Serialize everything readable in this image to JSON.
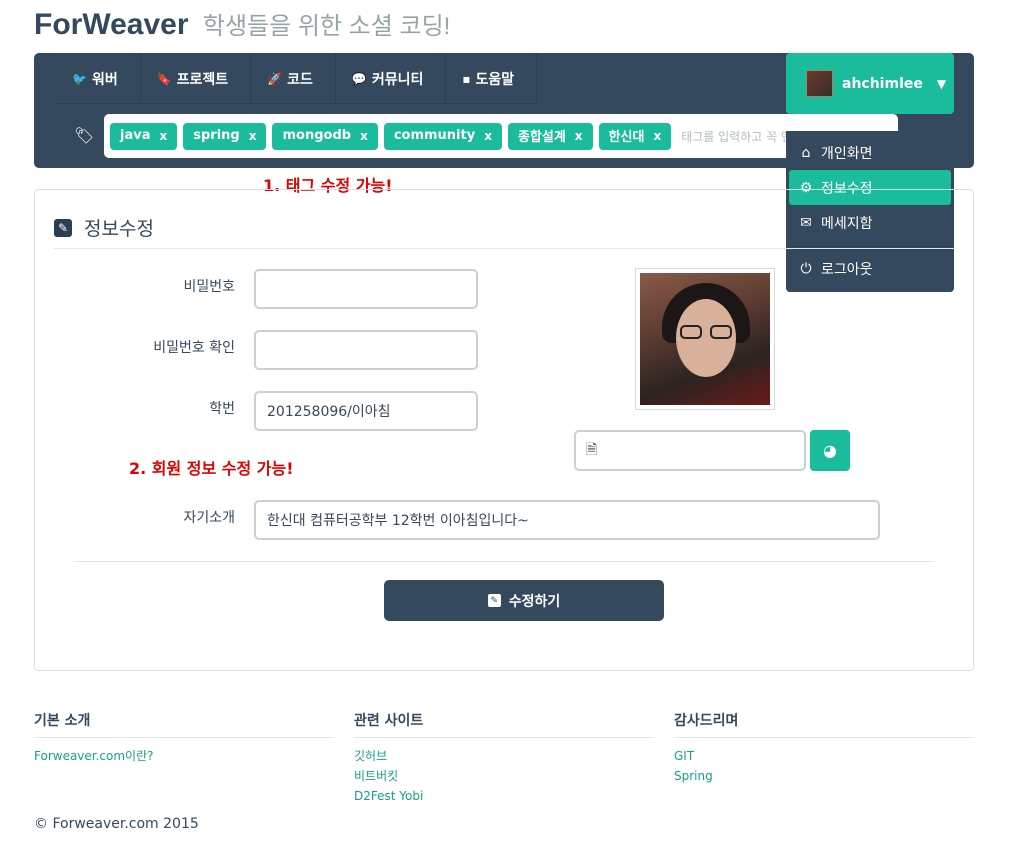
{
  "brand": {
    "name": "ForWeaver",
    "tagline": "학생들을 위한 소셜 코딩!"
  },
  "nav": {
    "items": [
      {
        "icon": "twitter-icon",
        "glyph": "🐦",
        "label": "워버"
      },
      {
        "icon": "bookmark-icon",
        "glyph": "🔖",
        "label": "프로젝트"
      },
      {
        "icon": "rocket-icon",
        "glyph": "🚀",
        "label": "코드"
      },
      {
        "icon": "comments-icon",
        "glyph": "💬",
        "label": "커뮤니티"
      },
      {
        "icon": "help-icon",
        "glyph": "▪",
        "label": "도움말"
      }
    ],
    "tags": [
      "java",
      "spring",
      "mongodb",
      "community",
      "종합설계",
      "한신대"
    ],
    "tag_remove": "x",
    "tag_placeholder": "태그를 입력하고 꼭 엔터!"
  },
  "user": {
    "name": "ahchimlee",
    "menu": [
      {
        "icon": "home-icon",
        "glyph": "⌂",
        "label": "개인화면"
      },
      {
        "icon": "gear-icon",
        "glyph": "⚙",
        "label": "정보수정"
      },
      {
        "icon": "envelope-icon",
        "glyph": "✉",
        "label": "메세지함"
      },
      {
        "icon": "power-icon",
        "glyph": "⏻",
        "label": "로그아웃"
      }
    ]
  },
  "notes": {
    "tag_edit": "1. 태그 수정 가능!",
    "member_edit": "2. 회원 정보 수정 가능!"
  },
  "form": {
    "title": "정보수정",
    "password_label": "비밀번호",
    "password_value": "",
    "password_confirm_label": "비밀번호 확인",
    "password_confirm_value": "",
    "student_id_label": "학번",
    "student_id_value": "201258096/이아침",
    "bio_label": "자기소개",
    "bio_value": "한신대 컴퓨터공학부 12학번 이아침입니다~",
    "file_value": "",
    "submit_label": "수정하기"
  },
  "footer": {
    "columns": [
      {
        "title": "기본 소개",
        "links": [
          "Forweaver.com이란?"
        ]
      },
      {
        "title": "관련 사이트",
        "links": [
          "깃허브",
          "비트버킷",
          "D2Fest Yobi"
        ]
      },
      {
        "title": "감사드리며",
        "links": [
          "GIT",
          "Spring"
        ]
      }
    ],
    "copyright": "© Forweaver.com 2015"
  },
  "colors": {
    "primary": "#34495e",
    "accent": "#1abc9c",
    "note": "#e00000"
  }
}
